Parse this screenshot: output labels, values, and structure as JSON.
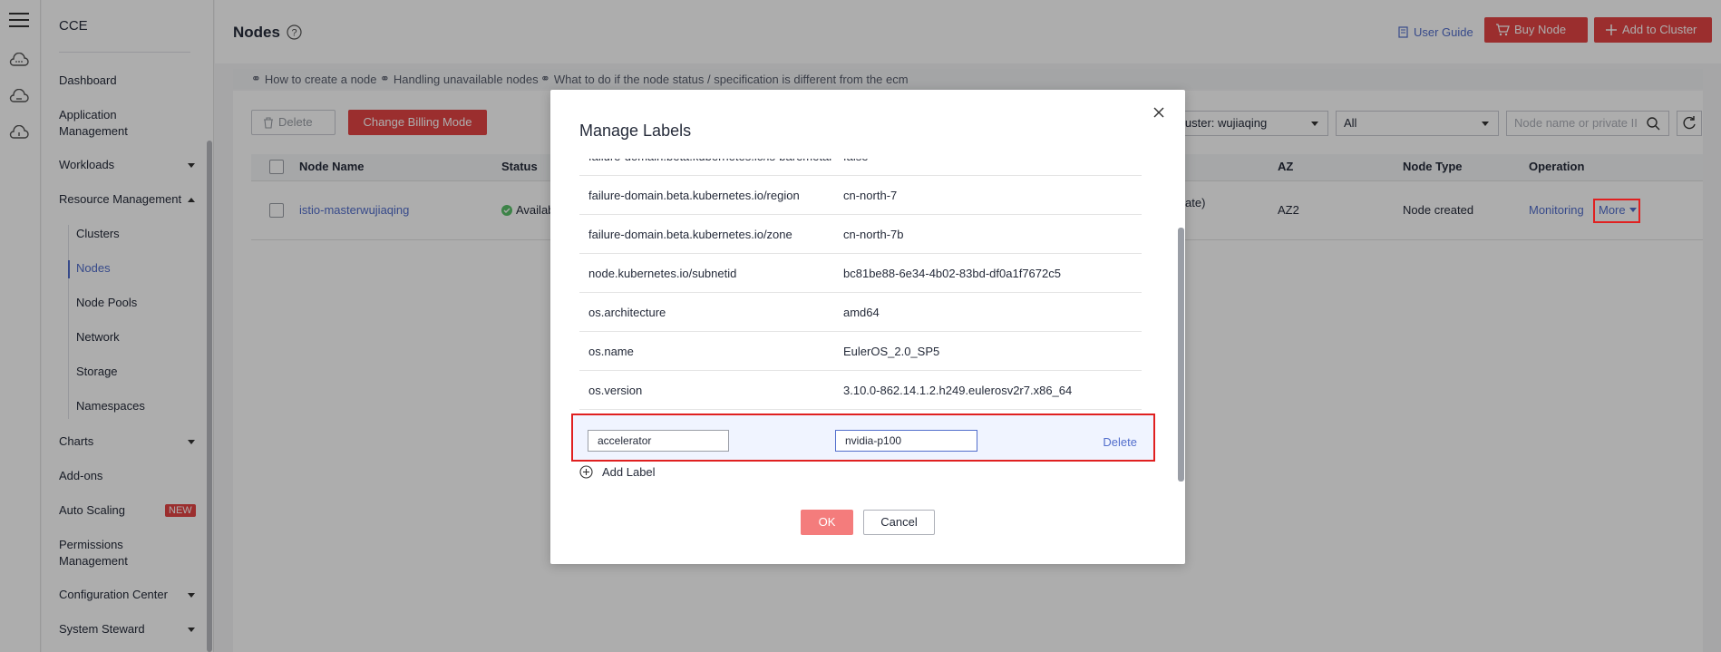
{
  "sidebar": {
    "brand": "CCE",
    "items": {
      "dashboard": "Dashboard",
      "application_management": "Application Management",
      "workloads": "Workloads",
      "resource_management": "Resource Management",
      "clusters": "Clusters",
      "nodes": "Nodes",
      "node_pools": "Node Pools",
      "network": "Network",
      "storage": "Storage",
      "namespaces": "Namespaces",
      "charts": "Charts",
      "addons": "Add-ons",
      "auto_scaling": "Auto Scaling",
      "auto_scaling_badge": "NEW",
      "permissions_management": "Permissions Management",
      "configuration_center": "Configuration Center",
      "system_steward": "System Steward"
    }
  },
  "header": {
    "title": "Nodes",
    "user_guide": "User Guide",
    "buy_node": "Buy Node",
    "add_to_cluster": "Add to Cluster"
  },
  "tips": [
    "How to create a node",
    "Handling unavailable nodes",
    "What to do if the node status / specification is different from the ecm"
  ],
  "toolbar": {
    "delete": "Delete",
    "change_billing": "Change Billing Mode",
    "cluster_select": "luster: wujiaqing",
    "az_select": "All",
    "search_placeholder": "Node name or private II"
  },
  "table": {
    "headers": {
      "node_name": "Node Name",
      "status": "Status",
      "az": "AZ",
      "node_type": "Node Type",
      "operation": "Operation"
    },
    "row": {
      "node_name": "istio-masterwujiaqing",
      "status": "Availab",
      "partial": "ate)",
      "az": "AZ2",
      "node_type": "Node created",
      "monitoring": "Monitoring",
      "more": "More"
    }
  },
  "modal": {
    "title": "Manage Labels",
    "labels": [
      {
        "key": "failure-domain.beta.kubernetes.io/is-baremetal",
        "value": "false"
      },
      {
        "key": "failure-domain.beta.kubernetes.io/region",
        "value": "cn-north-7"
      },
      {
        "key": "failure-domain.beta.kubernetes.io/zone",
        "value": "cn-north-7b"
      },
      {
        "key": "node.kubernetes.io/subnetid",
        "value": "bc81be88-6e34-4b02-83bd-df0a1f7672c5"
      },
      {
        "key": "os.architecture",
        "value": "amd64"
      },
      {
        "key": "os.name",
        "value": "EulerOS_2.0_SP5"
      },
      {
        "key": "os.version",
        "value": "3.10.0-862.14.1.2.h249.eulerosv2r7.x86_64"
      }
    ],
    "edit_key": "accelerator",
    "edit_value": "nvidia-p100",
    "edit_delete": "Delete",
    "add_label": "Add Label",
    "ok": "OK",
    "cancel": "Cancel"
  },
  "colors": {
    "accent": "#526ecc",
    "danger": "#e54545",
    "highlight": "#e02020"
  }
}
